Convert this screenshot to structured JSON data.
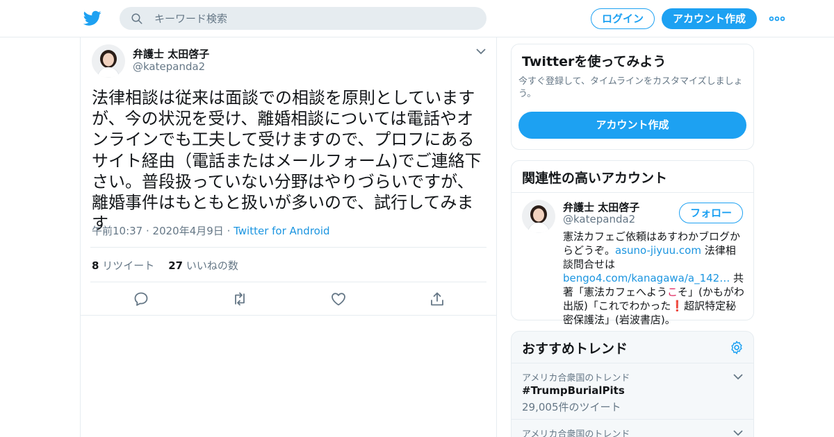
{
  "header": {
    "search_placeholder": "キーワード検索",
    "login_label": "ログイン",
    "signup_label": "アカウント作成"
  },
  "tweet": {
    "author_name": "弁護士 太田啓子",
    "author_handle": "@katepanda2",
    "text": "法律相談は従来は面談での相談を原則としていますが、今の状況を受け、離婚相談については電話やオンラインでも工夫して受けますので、プロフにあるサイト経由（電話またはメールフォーム)でご連絡下さい。普段扱っていない分野はやりづらいですが、離婚事件はもともと扱いが多いので、試行してみます",
    "timestamp": "午前10:37 · 2020年4月9日",
    "separator": " · ",
    "source": "Twitter for Android",
    "retweet_count": "8",
    "retweet_label": "リツイート",
    "like_count": "27",
    "like_label": "いいねの数"
  },
  "signup_card": {
    "title": "Twitterを使ってみよう",
    "description": "今すぐ登録して、タイムラインをカスタマイズしましょう。",
    "button_label": "アカウント作成"
  },
  "related_card": {
    "title": "関連性の高いアカウント",
    "name": "弁護士 太田啓子",
    "handle": "@katepanda2",
    "follow_label": "フォロー",
    "bio_1": "憲法カフェご依頼はあすわかブログからどうぞ。",
    "bio_link1": "asuno-jiyuu.com",
    "bio_2": " 法律相談問合せは",
    "bio_link2": "bengo4.com/kanagawa/a_142…",
    "bio_3": " 共著「憲法カフェへよう",
    "bio_hl": "こ",
    "bio_4": "そ」(かもがわ出版)「これでわかった",
    "bio_mark": "❗",
    "bio_5": "超訳特定秘密保護法」(岩波書店)。"
  },
  "trends_card": {
    "title": "おすすめトレンド",
    "trends": [
      {
        "context": "アメリカ合衆国のトレンド",
        "name": "#TrumpBurialPits",
        "count": "29,005件のツイート"
      },
      {
        "context": "アメリカ合衆国のトレンド"
      }
    ]
  },
  "colors": {
    "accent": "#1da1f2",
    "link": "#1b95e0",
    "muted": "#657786",
    "border": "#e6ecf0"
  },
  "icons": [
    "twitter-bird-icon",
    "search-icon",
    "more-dots-icon",
    "chevron-down-icon",
    "reply-icon",
    "retweet-icon",
    "like-heart-icon",
    "share-icon",
    "gear-icon"
  ]
}
